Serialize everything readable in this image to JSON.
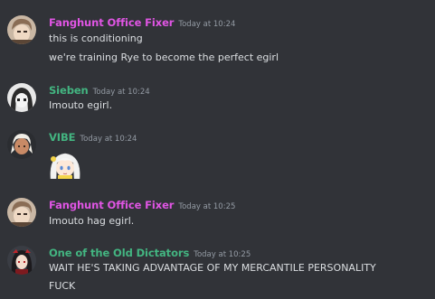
{
  "colors": {
    "background": "#313338",
    "username_pink": "#e055e4",
    "username_green": "#43b581",
    "text": "#dbdee1",
    "timestamp": "#949ba4"
  },
  "messages": [
    {
      "username": "Fanghunt Office Fixer",
      "timestamp": "Today at 10:24",
      "lines": [
        "this is conditioning",
        "we're training Rye to become the perfect egirl"
      ]
    },
    {
      "username": "Sieben",
      "timestamp": "Today at 10:24",
      "lines": [
        "Imouto egirl."
      ]
    },
    {
      "username": "VIBE",
      "timestamp": "Today at 10:24",
      "emoji_icon": "anime-girl-emoji"
    },
    {
      "username": "Fanghunt Office Fixer",
      "timestamp": "Today at 10:25",
      "lines": [
        "Imouto hag egirl."
      ]
    },
    {
      "username": "One of the Old Dictators",
      "timestamp": "Today at 10:25",
      "lines": [
        "WAIT HE'S TAKING ADVANTAGE OF MY MERCANTILE PERSONALITY",
        "FUCK"
      ]
    }
  ]
}
